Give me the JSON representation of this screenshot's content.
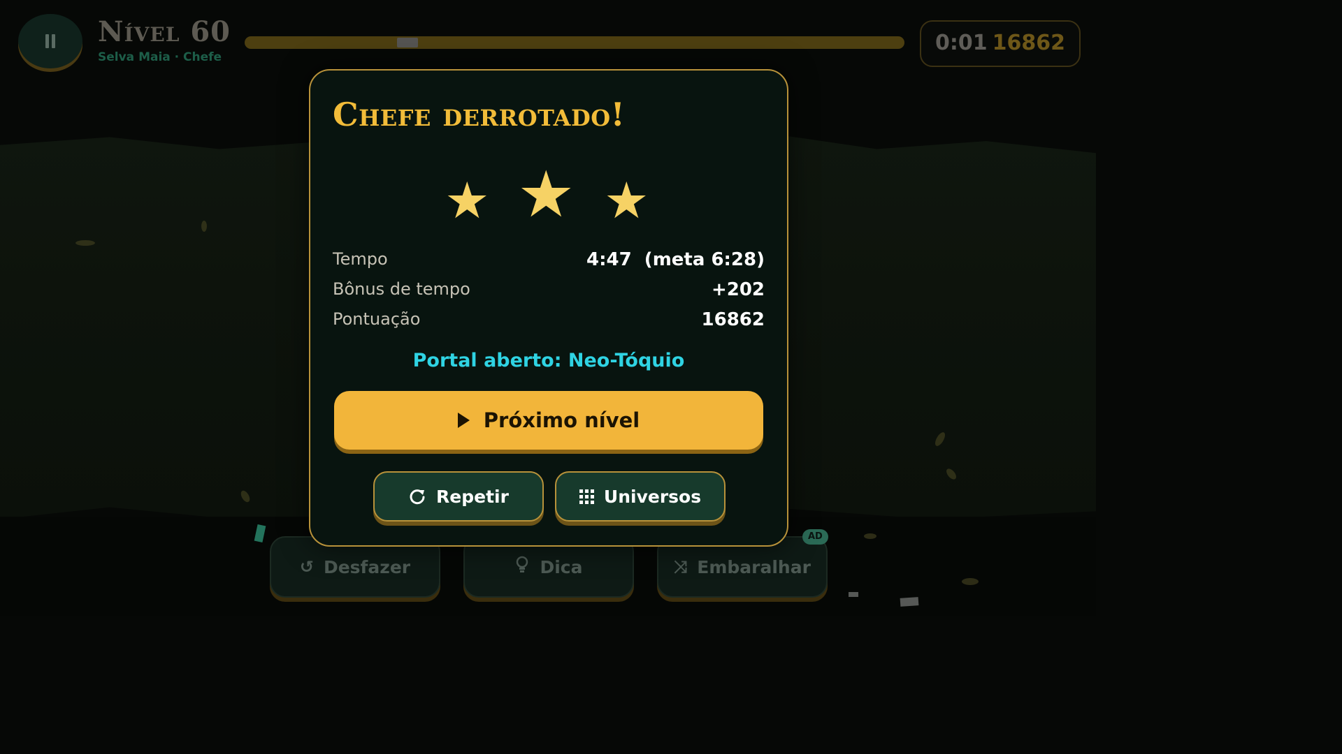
{
  "hud": {
    "level_title": "Nível 60",
    "level_subtitle": "Selva Maia · Chefe",
    "timer": "0:01",
    "score": "16862",
    "pause_icon": "pause-icon"
  },
  "actions": {
    "undo_label": "Desfazer",
    "hint_label": "Dica",
    "shuffle_label": "Embaralhar",
    "ad_badge": "AD"
  },
  "modal": {
    "title": "Chefe derrotado!",
    "stars_earned": 3,
    "stars_total": 3,
    "stats": [
      {
        "label": "Tempo",
        "value": "4:47  (meta 6:28)"
      },
      {
        "label": "Bônus de tempo",
        "value": "+202"
      },
      {
        "label": "Pontuação",
        "value": "16862"
      }
    ],
    "portal": "Portal aberto: Neo-Tóquio",
    "next_label": "Próximo nível",
    "retry_label": "Repetir",
    "universes_label": "Universos"
  },
  "colors": {
    "accent_gold": "#f2b53a",
    "title_gold": "#f2bc39",
    "portal_cyan": "#2fd3e3",
    "star": "#f6d265"
  }
}
